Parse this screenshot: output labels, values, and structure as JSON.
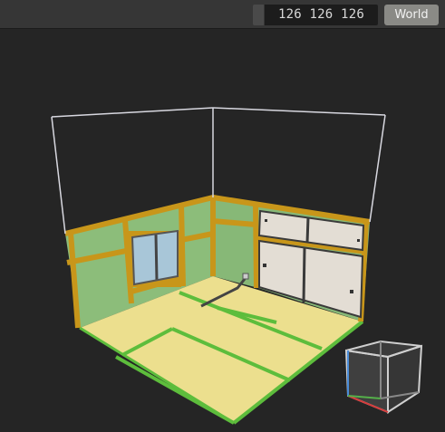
{
  "toolbar": {
    "dimensions": "126 126 126",
    "space_toggle_label": "World"
  },
  "scene": {
    "description_icons": [
      "room-model",
      "axis-gizmo"
    ]
  },
  "colors": {
    "background": "#252525",
    "tatami": "#ecdf8e",
    "tatami_border": "#5dbd3c",
    "wall": "#8cbd7a",
    "wood": "#c8961a",
    "shoji": "#e3ddd4",
    "window_glass": "#a8c6d8"
  }
}
